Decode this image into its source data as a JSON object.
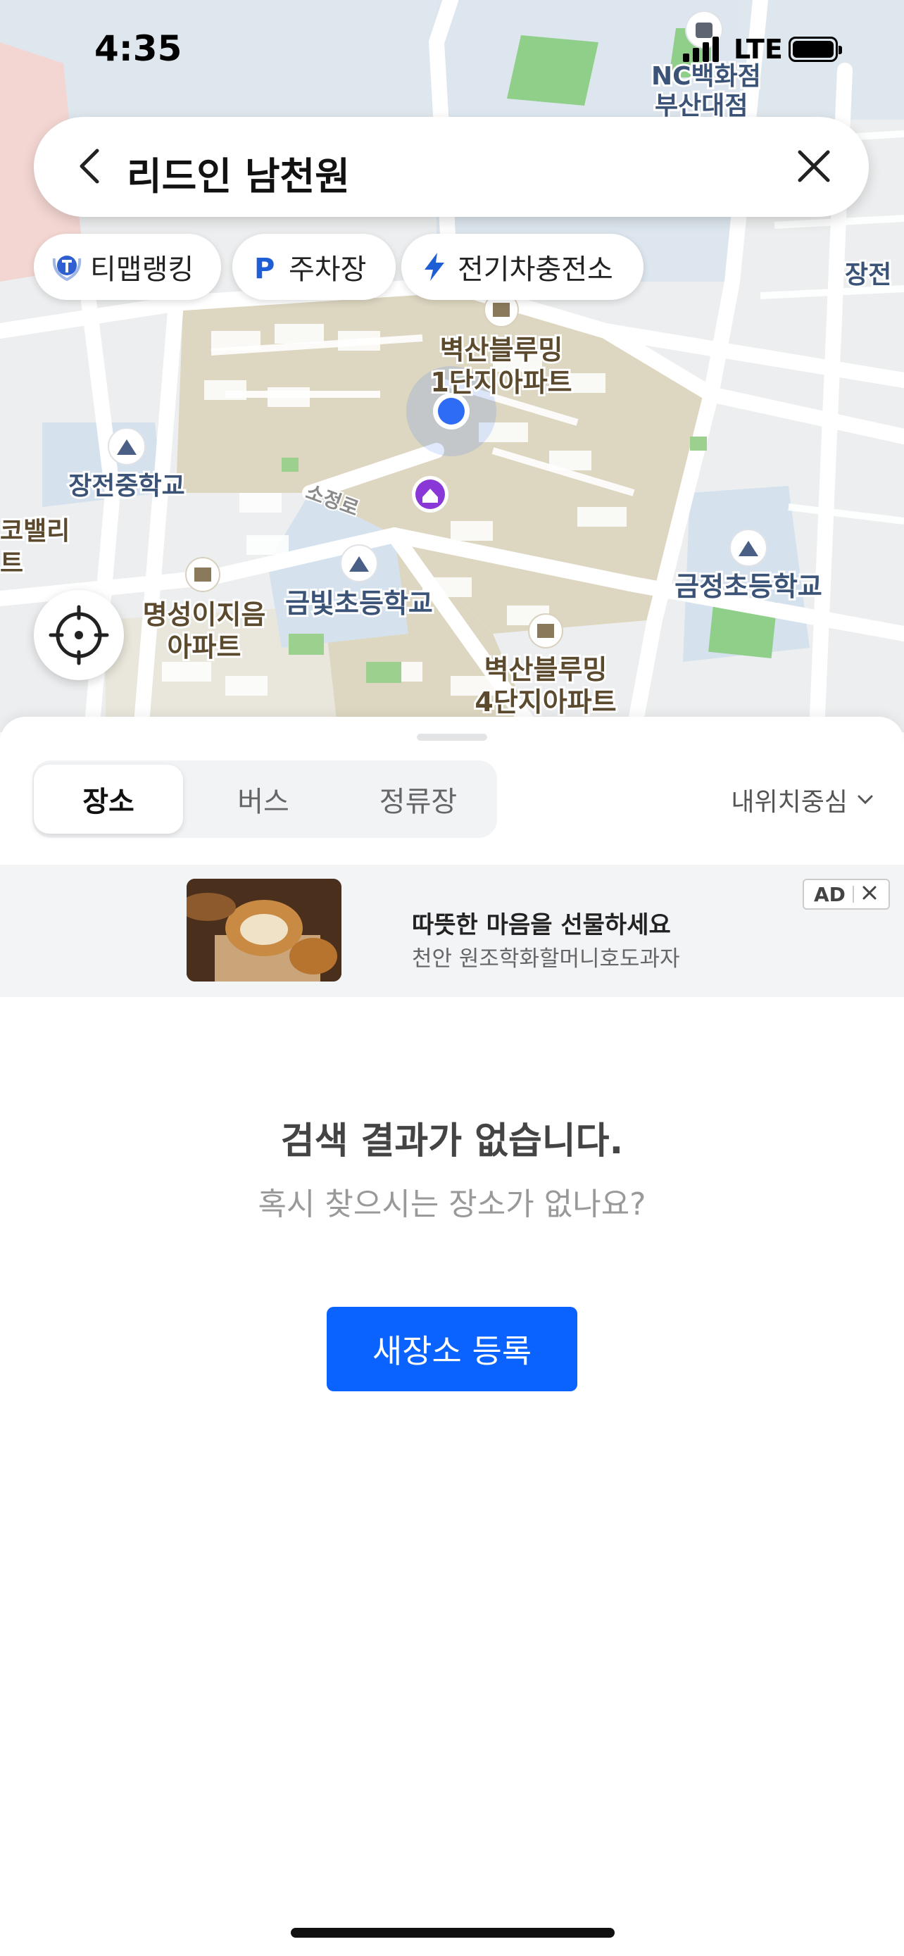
{
  "status_bar": {
    "time": "4:35",
    "network": "LTE"
  },
  "search": {
    "query": "리드인 남천원"
  },
  "chips": [
    {
      "label": "티맵랭킹",
      "icon": "tmap-ranking-icon"
    },
    {
      "label": "주차장",
      "icon": "parking-icon"
    },
    {
      "label": "전기차충전소",
      "icon": "lightning-icon"
    }
  ],
  "map": {
    "labels": {
      "nc": "NC백화점",
      "nc2": "부산대점",
      "apt1a": "벽산블루밍",
      "apt1b": "1단지아파트",
      "school1": "장전중학교",
      "valley1": "코밸리",
      "valley2": "트",
      "school2": "금빛초등학교",
      "myeong1": "명성이지음",
      "myeong2": "아파트",
      "apt4a": "벽산블루밍",
      "apt4b": "4단지아파트",
      "school3": "금정초등학교",
      "jangjeon": "장전",
      "road": "소정로"
    }
  },
  "tabs": [
    {
      "label": "장소",
      "active": true
    },
    {
      "label": "버스",
      "active": false
    },
    {
      "label": "정류장",
      "active": false
    }
  ],
  "sort": {
    "label": "내위치중심"
  },
  "ad": {
    "title": "따뜻한 마음을 선물하세요",
    "subtitle": "천안 원조학화할머니호도과자",
    "badge": "AD"
  },
  "empty": {
    "title": "검색 결과가 없습니다.",
    "subtitle": "혹시 찾으시는 장소가 없나요?",
    "button": "새장소 등록"
  },
  "colors": {
    "accent": "#0a63ff",
    "chip_blue": "#1f5fd6"
  }
}
